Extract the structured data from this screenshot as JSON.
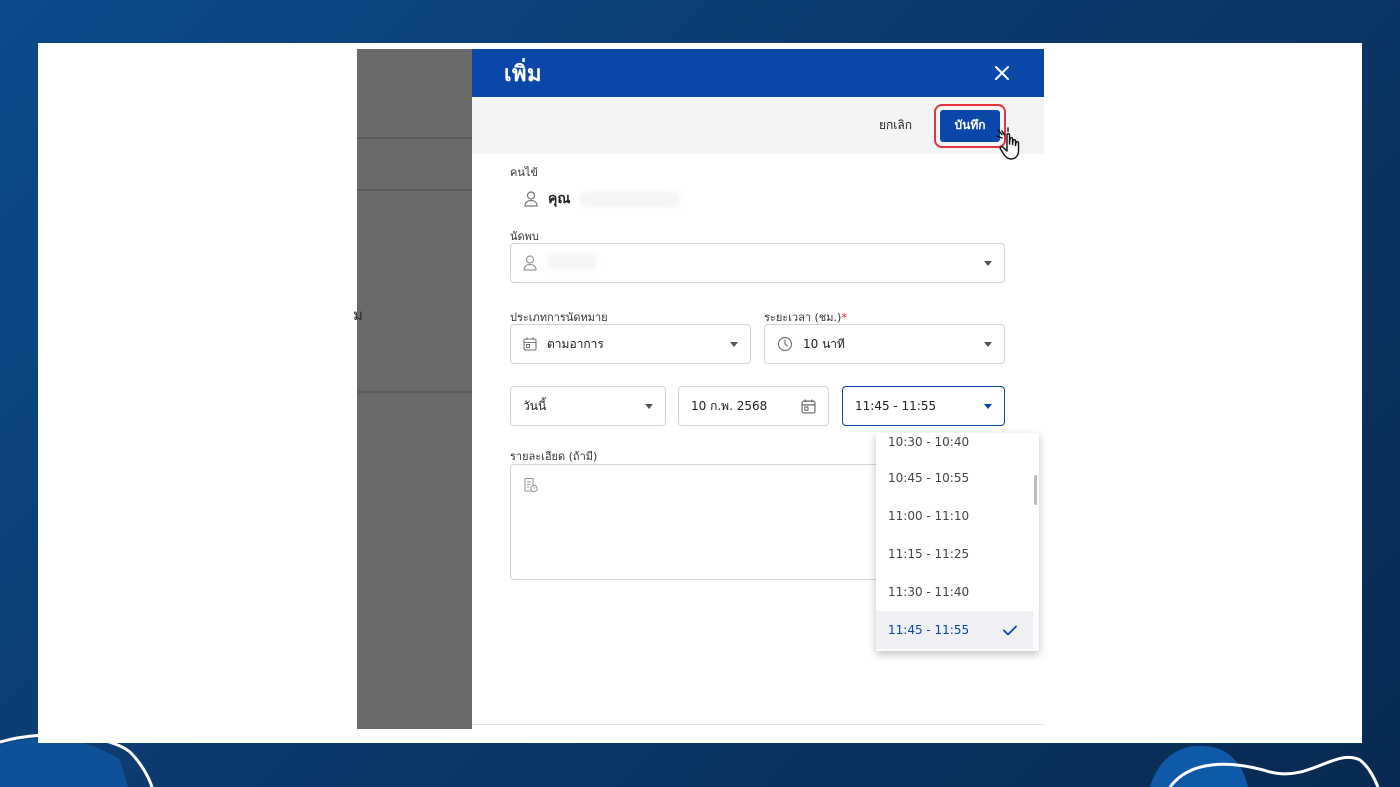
{
  "drawer": {
    "title": "เพิ่ม",
    "cancel_label": "ยกเลิก",
    "save_label": "บันทึก"
  },
  "patient": {
    "label": "คนไข้",
    "name_prefix": "คุณ"
  },
  "doctor": {
    "label": "นัดพบ"
  },
  "appointment_type": {
    "label": "ประเภทการนัดหมาย",
    "value": "ตามอาการ"
  },
  "duration": {
    "label": "ระยะเวลา (ชม.)",
    "required_mark": "*",
    "value": "10 นาที"
  },
  "day": {
    "value": "วันนี้"
  },
  "date": {
    "value": "10 ก.พ. 2568"
  },
  "time": {
    "value": "11:45 - 11:55",
    "options": [
      "10:30 - 10:40",
      "10:45 - 10:55",
      "11:00 - 11:10",
      "11:15 - 11:25",
      "11:30 - 11:40",
      "11:45 - 11:55"
    ],
    "selected_index": 5
  },
  "details": {
    "label": "รายละเอียด (ถ้ามี)"
  },
  "background_app": {
    "fragment": "ม"
  },
  "colors": {
    "primary": "#0a47a9",
    "highlight": "#e5323e",
    "required": "#e11d2a"
  }
}
